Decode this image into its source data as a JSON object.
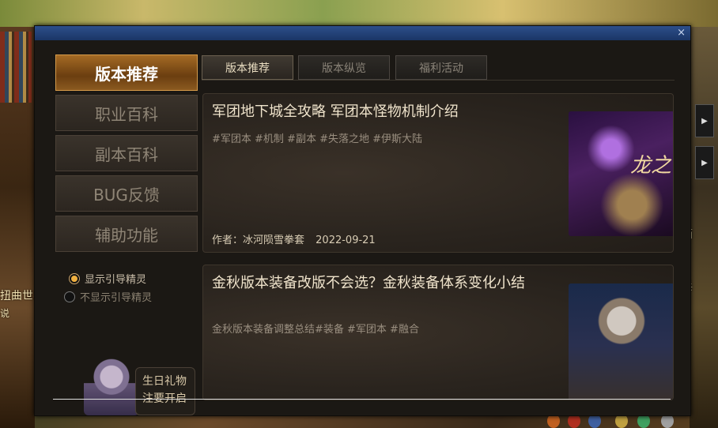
{
  "background": {
    "left_text": [
      "扭曲世界的",
      "说"
    ],
    "right_text": [
      "储箱",
      "积兵"
    ]
  },
  "window": {
    "close_label": "×"
  },
  "sidebar": {
    "items": [
      {
        "label": "版本推荐",
        "active": true
      },
      {
        "label": "职业百科",
        "active": false
      },
      {
        "label": "副本百科",
        "active": false
      },
      {
        "label": "BUG反馈",
        "active": false
      },
      {
        "label": "辅助功能",
        "active": false
      }
    ],
    "options": [
      {
        "label": "显示引导精灵",
        "checked": true
      },
      {
        "label": "不显示引导精灵",
        "checked": false
      }
    ],
    "gift_label": "生日礼物 注要开启"
  },
  "tabs": [
    {
      "label": "版本推荐",
      "active": true
    },
    {
      "label": "版本纵览",
      "active": false
    },
    {
      "label": "福利活动",
      "active": false
    }
  ],
  "articles": [
    {
      "title": "军团地下城全攻略 军团本怪物机制介绍",
      "tags": "#军团本 #机制 #副本 #失落之地 #伊斯大陆",
      "author": "作者：冰河陨雪拳套",
      "date": "2022-09-21",
      "image_text": "龙之"
    },
    {
      "title": "金秋版本装备改版不会选？金秋装备体系变化小结",
      "tags": "金秋版本装备调整总结#装备 #军团本 #融合"
    }
  ],
  "colors": {
    "title_bar": "#1b3566",
    "active_button": "#a46a24",
    "window_bg": "#1b1814"
  }
}
